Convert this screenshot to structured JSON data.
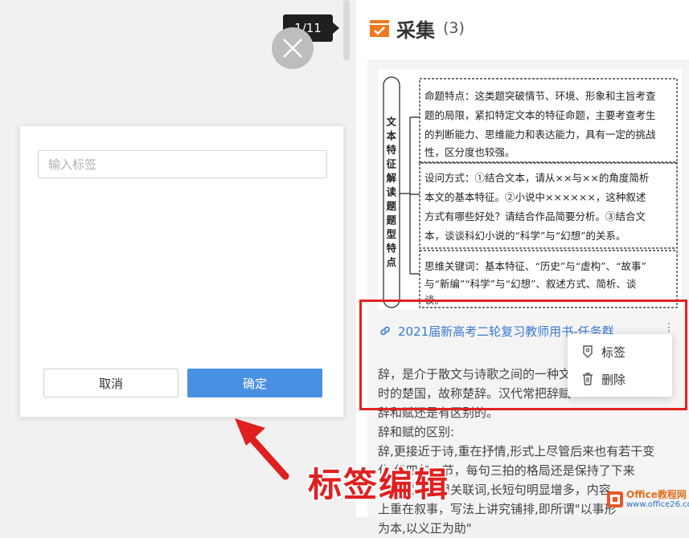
{
  "viewer": {
    "page_indicator": "1/11"
  },
  "dialog": {
    "input_placeholder": "输入标签",
    "cancel_label": "取消",
    "confirm_label": "确定"
  },
  "panel": {
    "title": "采集",
    "count": "(3)",
    "link_text": "2021届新高考二轮复习教师用书-任务群...",
    "body_lines": [
      "辞，是介于散文与诗歌之间的一种文体，起源于",
      "时的楚国，故称楚辞。汉代常把辞赋",
      "辞和赋还是有区别的。",
      "辞和赋的区别:",
      "辞,更接近于诗,重在抒情,形式上尽管后来也有若干变",
      "化,但四句一节，每句三拍的格局还是保持了下来",
      "语。赋，常用关联词,长短句明显增多，内容",
      "上重在叙事，写法上讲究铺排,即所谓\"以事形",
      "为本,以义正为助\""
    ]
  },
  "document_image": {
    "vertical_label": "文本特征解读题题型特点",
    "box1": [
      "命题特点：这类题突破情节、环境、形象和主旨考查",
      "题的局限，紧扣特定文本的特征命题，主要考查考生",
      "的判断能力、思维能力和表达能力，具有一定的挑战",
      "性，区分度也较强。"
    ],
    "box2": [
      "设问方式：①结合文本，请从××与××的角度简析",
      "本文的基本特征。②小说中××××××，这种叙述",
      "方式有哪些好处？请结合作品简要分析。③结合文",
      "本，谈谈科幻小说的“科学”与“幻想”的关系。"
    ],
    "box3": [
      "思维关键词：基本特征、“历史”与“虚构”、“故事”",
      "与“新编”“科学”与“幻想”、叙述方式、简析、谈",
      "谈。"
    ]
  },
  "context_menu": {
    "items": [
      {
        "label": "标签",
        "icon": "tag-icon"
      },
      {
        "label": "删除",
        "icon": "trash-icon"
      }
    ]
  },
  "annotation": {
    "caption": "标签编辑",
    "color": "#e02020"
  },
  "watermark": {
    "line1": "Office教程网",
    "line2": "www.office26.com"
  },
  "colors": {
    "accent_blue": "#4a90e2",
    "link_blue": "#3b7ad0",
    "collect_orange": "#f07a22",
    "highlight_red": "#e02222"
  }
}
